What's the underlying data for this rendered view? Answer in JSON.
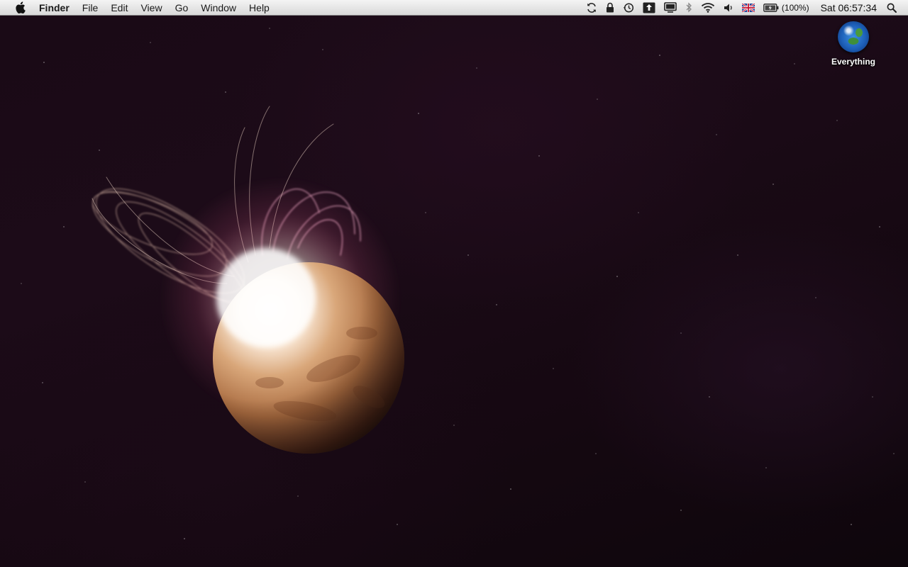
{
  "menubar": {
    "apple_menu": "apple-logo-icon",
    "app_name": "Finder",
    "menus": [
      "File",
      "Edit",
      "View",
      "Go",
      "Window",
      "Help"
    ],
    "status_icons": [
      "sync-icon",
      "lock-icon",
      "time-machine-icon",
      "ftp-upload-icon",
      "display-icon",
      "bluetooth-icon",
      "wifi-icon",
      "volume-icon",
      "uk-flag-icon",
      "battery-icon"
    ],
    "battery_percent": "(100%)",
    "clock": "Sat 06:57:34",
    "spotlight_icon": "magnifier-icon"
  },
  "desktop": {
    "icons": [
      {
        "label": "Everything",
        "icon": "globe-icon"
      }
    ]
  },
  "colors": {
    "menubar_bg": "#e6e6e6",
    "wallpaper_base": "#1a0a16",
    "flare_glow": "#fff4ea",
    "planet_surface": "#b7895c"
  }
}
